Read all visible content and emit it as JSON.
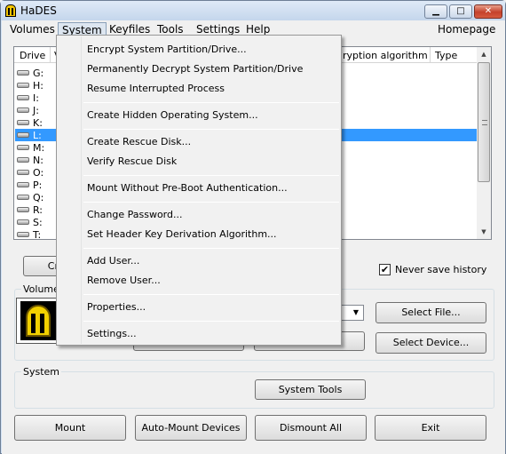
{
  "window": {
    "title": "HaDES"
  },
  "titlebar": {
    "minimize": "▁",
    "maximize": "□",
    "close": "✕"
  },
  "menubar": {
    "items": [
      "Volumes",
      "System",
      "Keyfiles",
      "Tools",
      "Settings",
      "Help"
    ],
    "homepage": "Homepage"
  },
  "drive_list": {
    "columns": [
      "Drive",
      "V",
      "ryption algorithm",
      "Type"
    ],
    "drives": [
      "G:",
      "H:",
      "I:",
      "J:",
      "K:",
      "L:",
      "M:",
      "N:",
      "O:",
      "P:",
      "Q:",
      "R:",
      "S:",
      "T:"
    ],
    "selected": "L:"
  },
  "controls": {
    "create_partial": "Cr",
    "never_save_history": "Never save history",
    "never_save_history_checked": true,
    "checkmark": "✔",
    "volume_group": "Volume",
    "select_file": "Select File...",
    "select_device": "Select Device...",
    "system_group": "System",
    "system_tools": "System Tools",
    "mount": "Mount",
    "auto_mount": "Auto-Mount Devices",
    "dismount_all": "Dismount All",
    "exit": "Exit"
  },
  "system_menu": {
    "items": [
      "Encrypt System Partition/Drive...",
      "Permanently Decrypt System Partition/Drive",
      "Resume Interrupted Process",
      "Create Hidden Operating System...",
      "Create Rescue Disk...",
      "Verify Rescue Disk",
      "Mount Without Pre-Boot Authentication...",
      "Change Password...",
      "Set Header Key Derivation Algorithm...",
      "Add User...",
      "Remove User...",
      "Properties...",
      "Settings..."
    ]
  },
  "icons": {
    "app": "hades-app-icon",
    "drive": "drive-icon",
    "scroll_up": "▲",
    "scroll_down": "▼",
    "combo_arrow": "▼"
  }
}
